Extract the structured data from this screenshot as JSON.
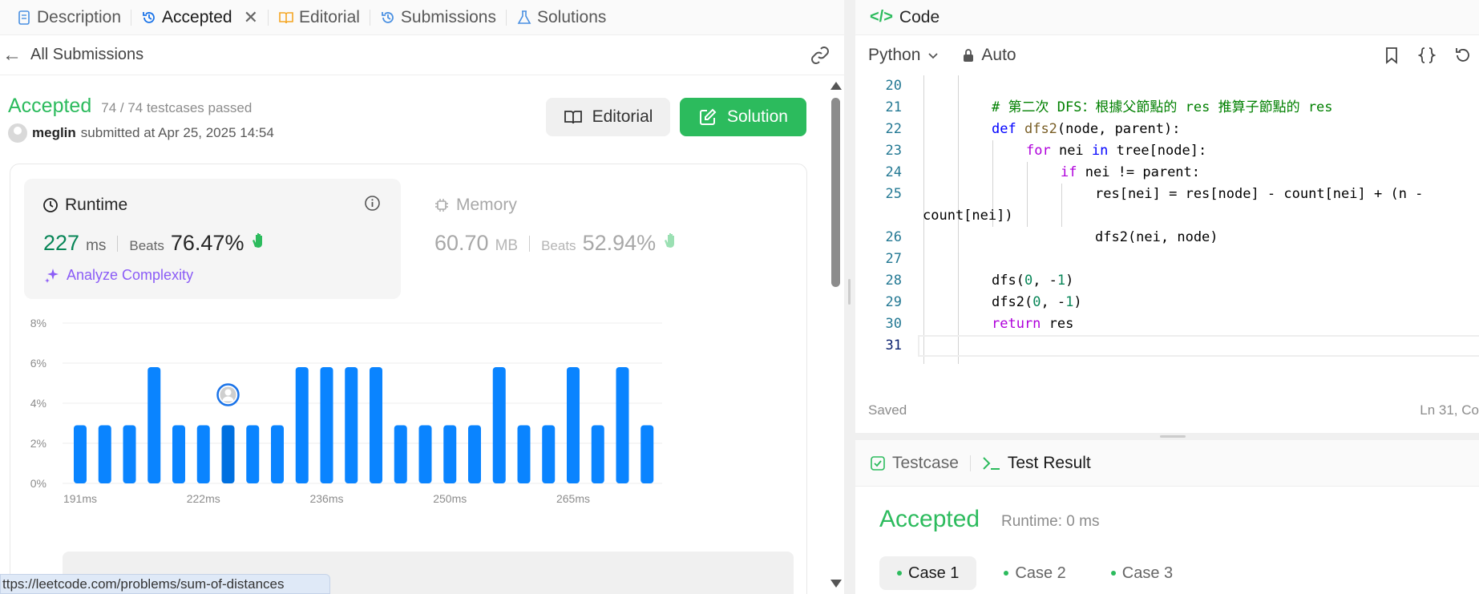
{
  "left_tabs": [
    {
      "label": "Description",
      "icon": "doc-icon"
    },
    {
      "label": "Accepted",
      "icon": "history-icon"
    },
    {
      "label": "Editorial",
      "icon": "book-icon"
    },
    {
      "label": "Submissions",
      "icon": "history-icon"
    },
    {
      "label": "Solutions",
      "icon": "flask-icon"
    }
  ],
  "subbar": {
    "back_label": "All Submissions"
  },
  "result": {
    "status": "Accepted",
    "testcases": "74 / 74 testcases passed",
    "user": "meglin",
    "submitted": "submitted at Apr 25, 2025 14:54",
    "editorial_btn": "Editorial",
    "solution_btn": "Solution"
  },
  "runtime": {
    "title": "Runtime",
    "value": "227",
    "unit": "ms",
    "beats_label": "Beats",
    "beats": "76.47%",
    "analyze": "Analyze Complexity"
  },
  "memory": {
    "title": "Memory",
    "value": "60.70",
    "unit": "MB",
    "beats_label": "Beats",
    "beats": "52.94%"
  },
  "colors": {
    "accent": "#2cbb5d",
    "bar": "#0a84ff",
    "bar_selected": "#0070e0",
    "purple": "#8b5cf6"
  },
  "chart_data": {
    "type": "bar",
    "ylim": [
      0,
      8
    ],
    "yticks": [
      "8%",
      "6%",
      "4%",
      "2%",
      "0%"
    ],
    "ytick_values": [
      8,
      6,
      4,
      2,
      0
    ],
    "xtick_labels": [
      "191ms",
      "222ms",
      "236ms",
      "250ms",
      "265ms"
    ],
    "xtick_at_bar": [
      0,
      5,
      10,
      15,
      20
    ],
    "values": [
      2.9,
      2.9,
      2.9,
      5.8,
      2.9,
      2.9,
      2.9,
      2.9,
      2.9,
      5.8,
      5.8,
      5.8,
      5.8,
      2.9,
      2.9,
      2.9,
      2.9,
      5.8,
      2.9,
      2.9,
      5.8,
      2.9,
      5.8,
      2.9
    ],
    "selected_index": 6,
    "grid": true
  },
  "status_url": "ttps://leetcode.com/problems/sum-of-distances",
  "code_panel": {
    "title": "Code",
    "language": "Python",
    "mode": "Auto",
    "saved": "Saved",
    "position": "Ln 31, Co"
  },
  "code_lines": [
    {
      "n": "20",
      "t": ""
    },
    {
      "n": "21",
      "t": "# 第二次 DFS：根據父節點的 res 推算子節點的 res"
    },
    {
      "n": "22",
      "t": "def dfs2(node, parent):"
    },
    {
      "n": "23",
      "t": "for nei in tree[node]:"
    },
    {
      "n": "24",
      "t": "if nei != parent:"
    },
    {
      "n": "25",
      "t": "res[nei] = res[node] - count[nei] + (n -"
    },
    {
      "n": "",
      "t": "count[nei])"
    },
    {
      "n": "26",
      "t": "dfs2(nei, node)"
    },
    {
      "n": "27",
      "t": ""
    },
    {
      "n": "28",
      "t": "dfs(0, -1)"
    },
    {
      "n": "29",
      "t": "dfs2(0, -1)"
    },
    {
      "n": "30",
      "t": "return res"
    },
    {
      "n": "31",
      "t": ""
    }
  ],
  "bottom": {
    "testcase_tab": "Testcase",
    "result_tab": "Test Result",
    "status": "Accepted",
    "runtime": "Runtime: 0 ms",
    "cases": [
      "Case 1",
      "Case 2",
      "Case 3"
    ]
  }
}
